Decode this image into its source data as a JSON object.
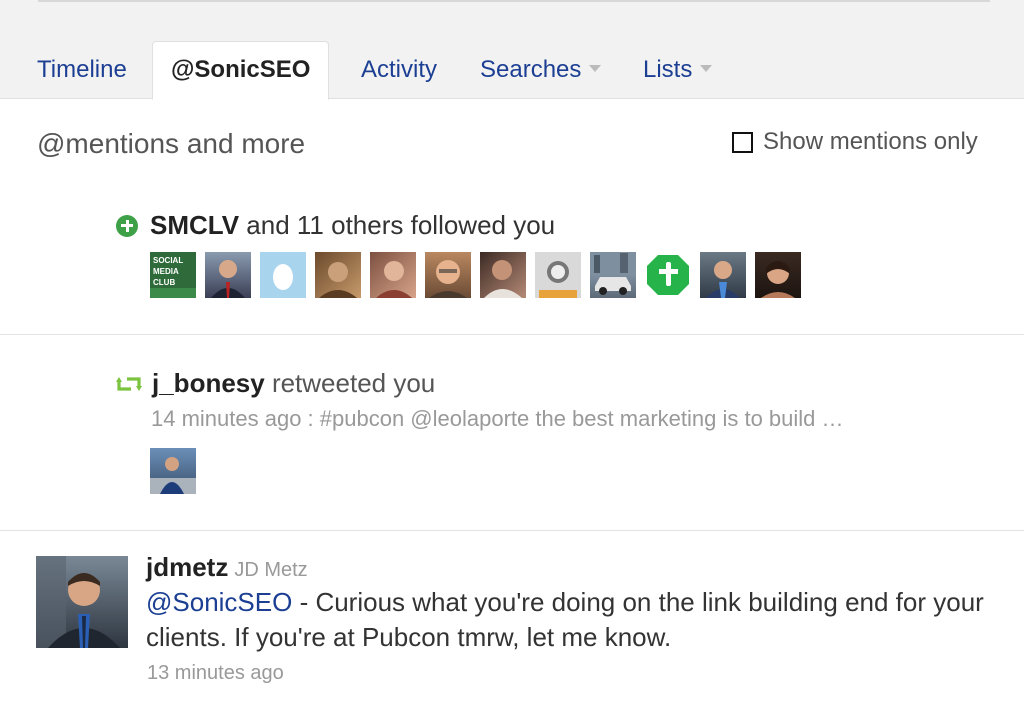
{
  "tabs": [
    {
      "label": "Timeline",
      "active": false,
      "dropdown": false
    },
    {
      "label": "@SonicSEO",
      "active": true,
      "dropdown": false
    },
    {
      "label": "Activity",
      "active": false,
      "dropdown": false
    },
    {
      "label": "Searches",
      "active": false,
      "dropdown": true
    },
    {
      "label": "Lists",
      "active": false,
      "dropdown": true
    }
  ],
  "section": {
    "title": "@mentions and more",
    "toggle_label": "Show mentions only",
    "toggle_checked": false
  },
  "follow_notice": {
    "icon": "plus-circle-icon",
    "user": "SMCLV",
    "text": " and 11 others followed you",
    "avatars": [
      "social-media-club-avatar",
      "man-in-suit-avatar",
      "default-egg-avatar",
      "person-avatar",
      "person-avatar",
      "smiling-man-avatar",
      "person-avatar",
      "bw-portrait-avatar",
      "car-avatar",
      "green-t-logo-avatar",
      "man-blue-shirt-avatar",
      "woman-avatar"
    ],
    "club_logo_text": [
      "SOCIAL",
      "MEDIA",
      "CLUB"
    ]
  },
  "retweet_notice": {
    "icon": "retweet-icon",
    "user": "j_bonesy",
    "text": " retweeted you",
    "meta": "14 minutes ago : #pubcon @leolaporte the best marketing is to build …"
  },
  "tweet": {
    "username": "jdmetz",
    "fullname": "JD Metz",
    "mention": "@SonicSEO",
    "text": " - Curious what you're doing on the link building end for your clients. If you're at Pubcon tmrw, let me know.",
    "time": "13 minutes ago"
  },
  "colors": {
    "link": "#1c3f94",
    "follow_green": "#3ea047",
    "retweet_green": "#7cc33f",
    "muted": "#999999"
  }
}
